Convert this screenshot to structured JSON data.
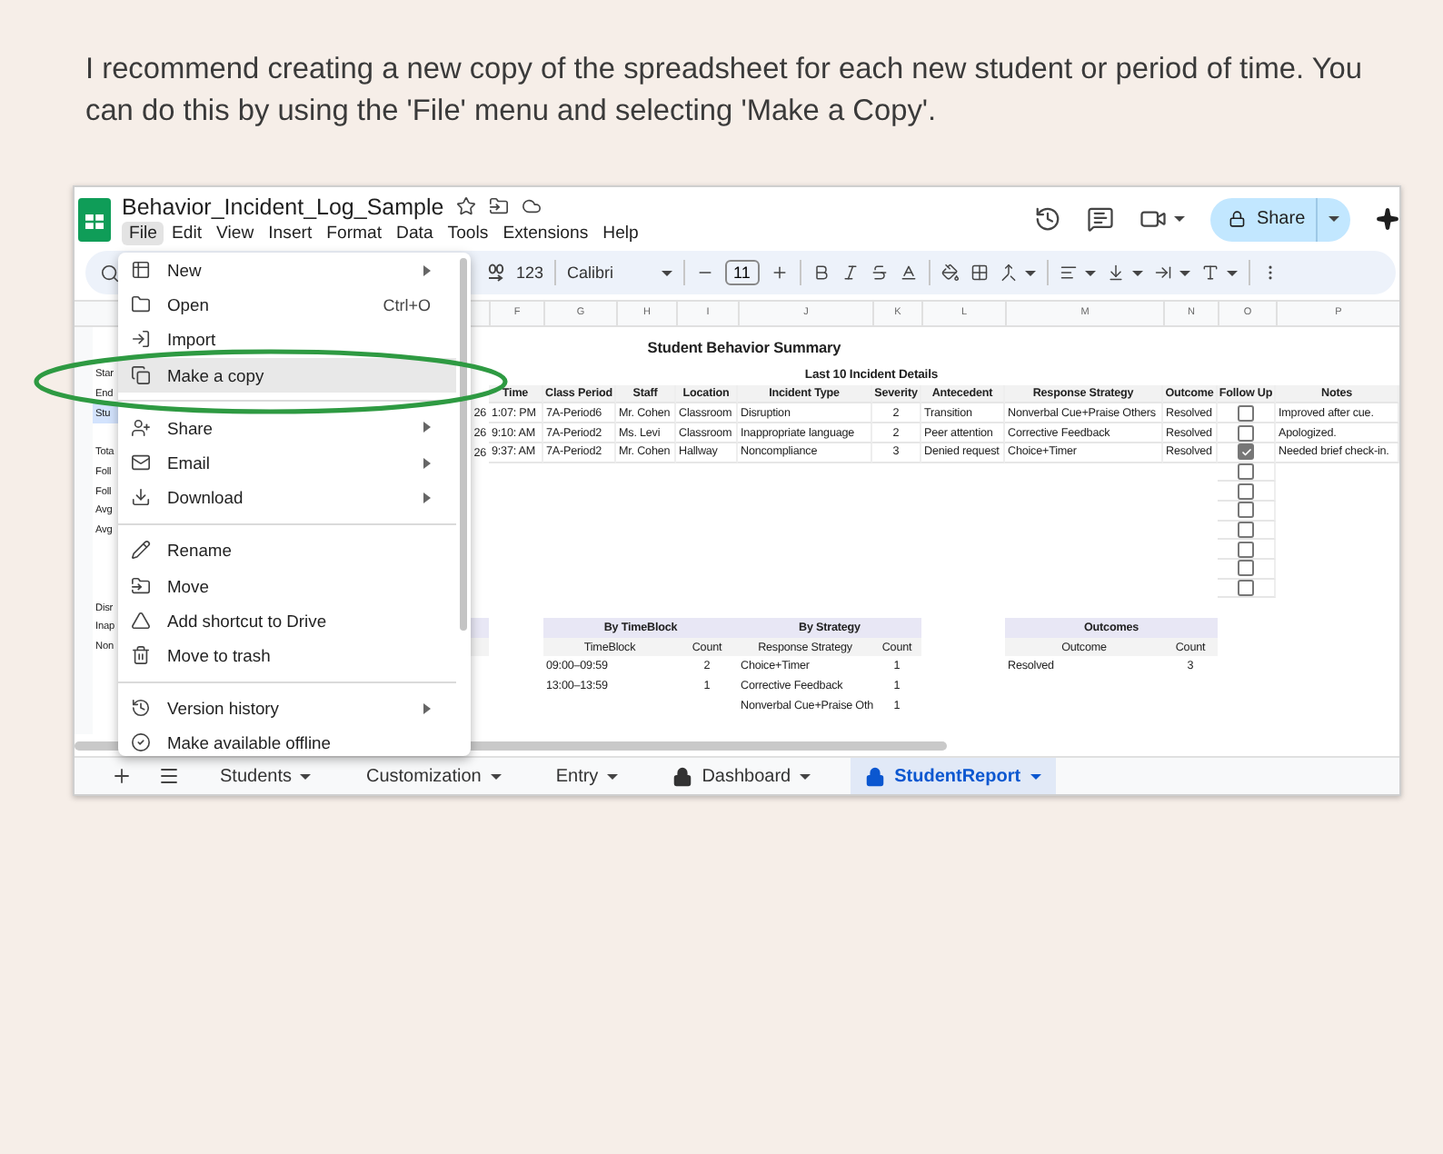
{
  "caption": "I recommend creating a new copy of the spreadsheet for each new student or period of time. You can do this by using the 'File' menu and selecting 'Make a Copy'.",
  "app": {
    "title": "Behavior_Incident_Log_Sample",
    "share": "Share",
    "menus": [
      {
        "label": "File",
        "selected": true
      },
      {
        "label": "Edit",
        "selected": false
      },
      {
        "label": "View",
        "selected": false
      },
      {
        "label": "Insert",
        "selected": false
      },
      {
        "label": "Format",
        "selected": false
      },
      {
        "label": "Data",
        "selected": false
      },
      {
        "label": "Tools",
        "selected": false
      },
      {
        "label": "Extensions",
        "selected": false
      },
      {
        "label": "Help",
        "selected": false
      }
    ]
  },
  "toolbar": {
    "number_format": "123",
    "font": "Calibri",
    "font_size": "11"
  },
  "file_menu": {
    "groups": [
      [
        {
          "label": "New",
          "submenu": true,
          "selected": false
        },
        {
          "label": "Open",
          "shortcut": "Ctrl+O",
          "submenu": false,
          "selected": false
        },
        {
          "label": "Import",
          "submenu": false,
          "selected": false
        },
        {
          "label": "Make a copy",
          "submenu": false,
          "selected": true
        }
      ],
      [
        {
          "label": "Share",
          "submenu": true,
          "selected": false
        },
        {
          "label": "Email",
          "submenu": true,
          "selected": false
        },
        {
          "label": "Download",
          "submenu": true,
          "selected": false
        }
      ],
      [
        {
          "label": "Rename",
          "submenu": false,
          "selected": false
        },
        {
          "label": "Move",
          "submenu": false,
          "selected": false
        },
        {
          "label": "Add shortcut to Drive",
          "submenu": false,
          "selected": false
        },
        {
          "label": "Move to trash",
          "submenu": false,
          "selected": false
        }
      ],
      [
        {
          "label": "Version history",
          "submenu": true,
          "selected": false
        },
        {
          "label": "Make available offline",
          "submenu": false,
          "selected": false
        }
      ]
    ]
  },
  "sheet": {
    "column_letters": [
      "F",
      "G",
      "H",
      "I",
      "J",
      "K",
      "L",
      "M",
      "N",
      "O",
      "P"
    ],
    "report_title": "Student Behavior Summary",
    "section_title": "Last 10 Incident Details",
    "left_cells": [
      {
        "text": "Star",
        "selected": false
      },
      {
        "text": "End",
        "selected": false
      },
      {
        "text": "Stu",
        "selected": true
      },
      {
        "text": "Tota",
        "selected": false
      },
      {
        "text": "Foll",
        "selected": false
      },
      {
        "text": "Foll",
        "selected": false
      },
      {
        "text": "Avg",
        "selected": false
      },
      {
        "text": "Avg",
        "selected": false
      },
      {
        "text": "Disr",
        "selected": false
      },
      {
        "text": "Inap",
        "selected": false
      },
      {
        "text": "Non",
        "selected": false
      }
    ],
    "incidents": {
      "columns": [
        "Time",
        "Class Period",
        "Staff",
        "Location",
        "Incident Type",
        "Severity",
        "Antecedent",
        "Response Strategy",
        "Outcome",
        "Follow Up",
        "Notes"
      ],
      "rows": [
        {
          "date": "26",
          "cells": [
            "1:07: PM",
            "7A-Period6",
            "Mr. Cohen",
            "Classroom",
            "Disruption",
            "2",
            "Transition",
            "Nonverbal Cue+Praise Others",
            "Resolved"
          ],
          "follow_up": false,
          "notes": "Improved after cue."
        },
        {
          "date": "26",
          "cells": [
            "9:10: AM",
            "7A-Period2",
            "Ms. Levi",
            "Classroom",
            "Inappropriate language",
            "2",
            "Peer attention",
            "Corrective Feedback",
            "Resolved"
          ],
          "follow_up": false,
          "notes": "Apologized."
        },
        {
          "date": "26",
          "cells": [
            "9:37: AM",
            "7A-Period2",
            "Mr. Cohen",
            "Hallway",
            "Noncompliance",
            "3",
            "Denied request",
            "Choice+Timer",
            "Resolved"
          ],
          "follow_up": true,
          "notes": "Needed brief check-in."
        },
        {
          "follow_up": false
        },
        {
          "follow_up": false
        },
        {
          "follow_up": false
        },
        {
          "follow_up": false
        },
        {
          "follow_up": false
        },
        {
          "follow_up": false
        },
        {
          "follow_up": false
        }
      ]
    },
    "summaries": [
      {
        "title": "By TimeBlock",
        "columns": [
          "TimeBlock",
          "Count"
        ],
        "rows": [
          [
            "09:00–09:59",
            "2"
          ],
          [
            "13:00–13:59",
            "1"
          ]
        ]
      },
      {
        "title": "By Strategy",
        "columns": [
          "Response Strategy",
          "Count"
        ],
        "rows": [
          [
            "Choice+Timer",
            "1"
          ],
          [
            "Corrective Feedback",
            "1"
          ],
          [
            "Nonverbal Cue+Praise Oth",
            "1"
          ]
        ]
      },
      {
        "title": "Outcomes",
        "columns": [
          "Outcome",
          "Count"
        ],
        "rows": [
          [
            "Resolved",
            "3"
          ]
        ]
      }
    ]
  },
  "tabs": [
    {
      "label": "Students",
      "locked": false,
      "selected": false
    },
    {
      "label": "Customization",
      "locked": false,
      "selected": false
    },
    {
      "label": "Entry",
      "locked": false,
      "selected": false
    },
    {
      "label": "Dashboard",
      "locked": true,
      "selected": false
    },
    {
      "label": "StudentReport",
      "locked": true,
      "selected": true
    }
  ]
}
